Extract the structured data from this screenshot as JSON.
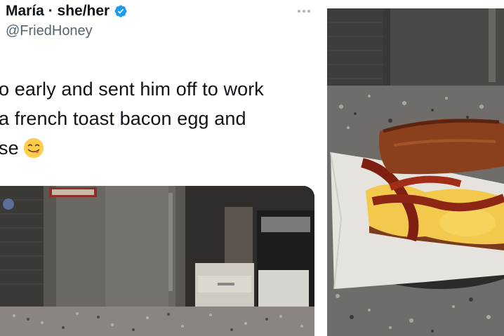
{
  "tweet": {
    "display_name": "María · she/her",
    "handle": "@FriedHoney",
    "text_lines": [
      "o early and sent him off to work",
      "a french toast bacon egg and",
      "se"
    ],
    "emoji": "savoring-food-emoji"
  },
  "media": [
    {
      "description": "kitchen-photo"
    },
    {
      "description": "sandwich-photo"
    }
  ],
  "colors": {
    "verified": "#1d9bf0",
    "text": "#0f1419",
    "secondary": "#536471"
  }
}
